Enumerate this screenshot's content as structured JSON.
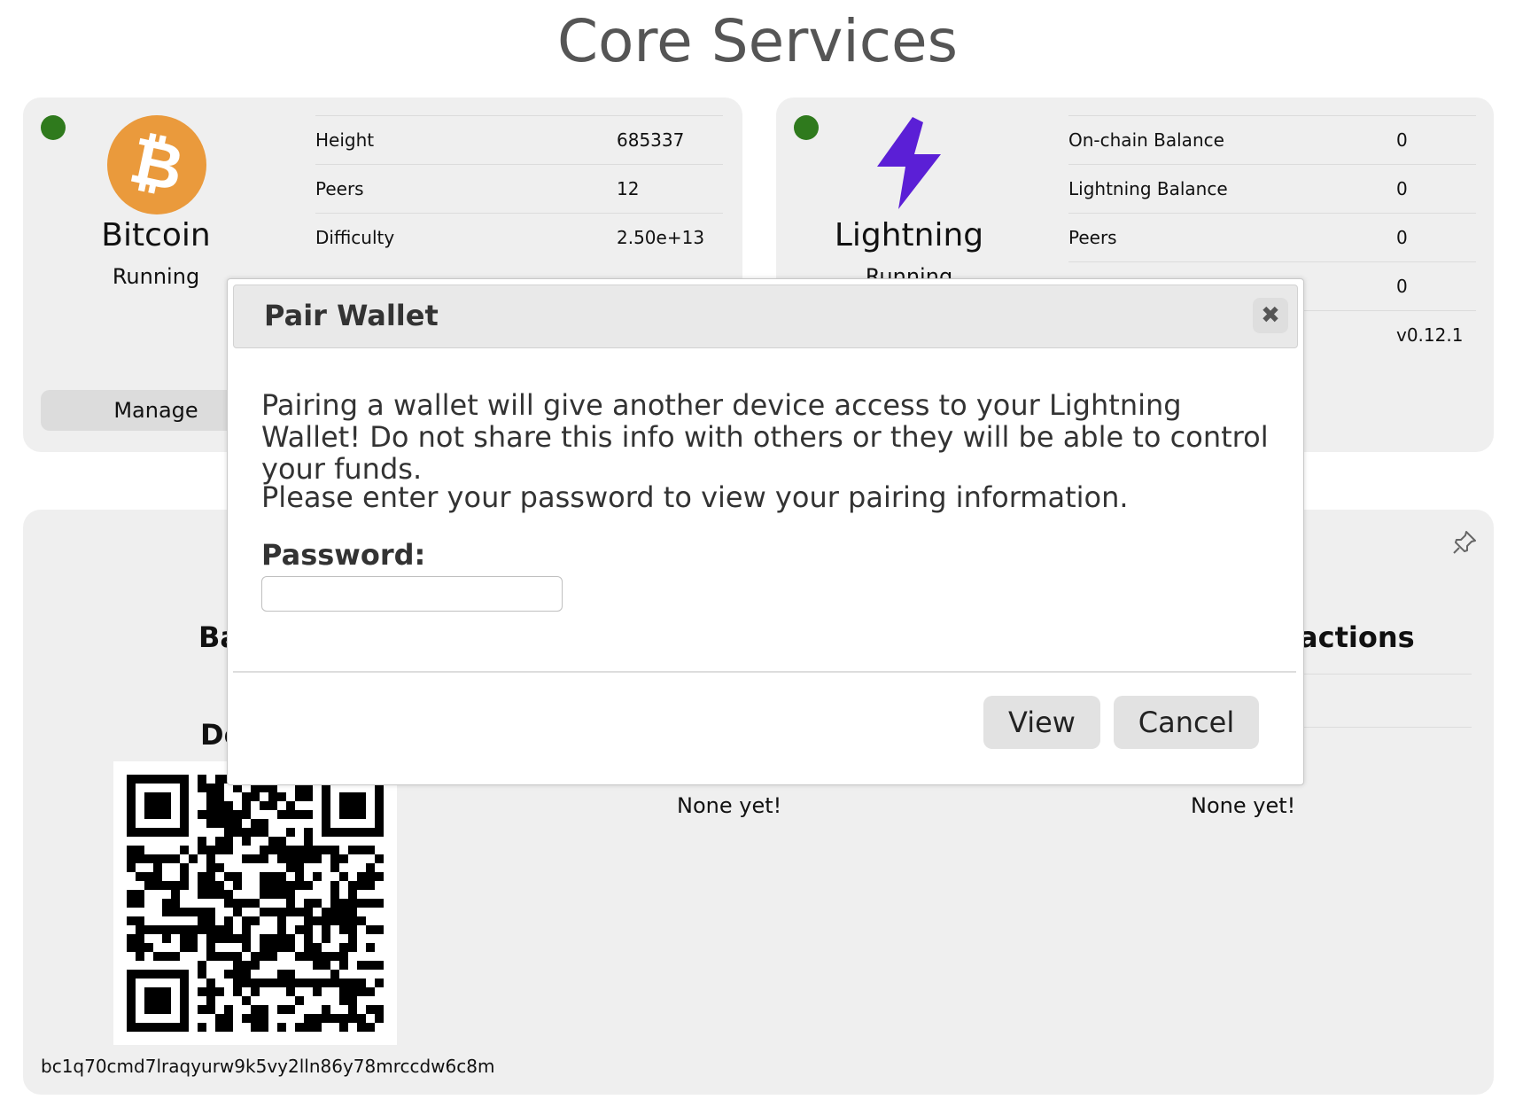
{
  "page": {
    "title": "Core Services"
  },
  "bitcoin": {
    "name": "Bitcoin",
    "status": "Running",
    "manage_label": "Manage",
    "stats": [
      {
        "label": "Height",
        "value": "685337"
      },
      {
        "label": "Peers",
        "value": "12"
      },
      {
        "label": "Difficulty",
        "value": "2.50e+13"
      }
    ],
    "icon": "bitcoin-logo-icon",
    "icon_color": "#ea9a3c",
    "status_color": "#2f7a1d"
  },
  "lightning": {
    "name": "Lightning",
    "status": "Running",
    "stats": [
      {
        "label": "On-chain Balance",
        "value": "0"
      },
      {
        "label": "Lightning Balance",
        "value": "0"
      },
      {
        "label": "Peers",
        "value": "0"
      },
      {
        "label": "",
        "value": "0"
      },
      {
        "label": "",
        "value": "v0.12.1"
      }
    ],
    "icon": "lightning-bolt-icon",
    "icon_color": "#5b1fd6"
  },
  "wallet": {
    "balance_heading_partial": "Ba",
    "deposit_heading_partial": "De",
    "transactions_heading_partial": "actions",
    "middle_empty": "None yet!",
    "right_empty": "None yet!",
    "address": "bc1q70cmd7lraqyurw9k5vy2lln86y78mrccdw6c8m"
  },
  "modal": {
    "title": "Pair Wallet",
    "close_icon": "close-icon",
    "warning": "Pairing a wallet will give another device access to your Lightning Wallet! Do not share this info with others or they will be able to control your funds.",
    "instruction": "Please enter your password to view your pairing information.",
    "password_label": "Password:",
    "password_value": "",
    "view_label": "View",
    "cancel_label": "Cancel"
  }
}
